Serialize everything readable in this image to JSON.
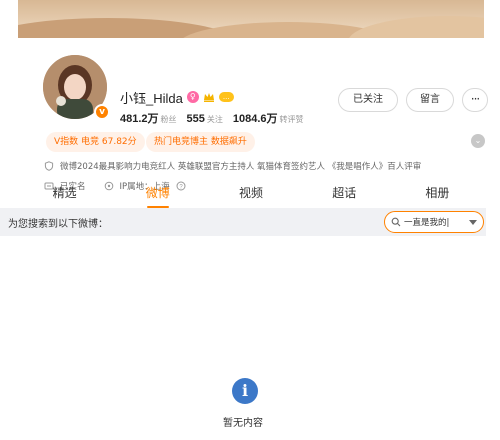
{
  "profile": {
    "name": "小钰_Hilda",
    "verified_badge": "v",
    "gender_icon": "female-icon",
    "vip_label": "...",
    "stats": [
      {
        "value": "481.2万",
        "label": "粉丝"
      },
      {
        "value": "555",
        "label": "关注"
      },
      {
        "value": "1084.6万",
        "label": "转评赞"
      }
    ],
    "actions": {
      "follow_label": "已关注",
      "message_label": "留言",
      "more_label": "···"
    },
    "tags": [
      "V指数 电竞 67.82分",
      "热门电竞博主 数据飙升"
    ],
    "bio": "微博2024最具影响力电竞红人 英雄联盟官方主持人 氧猫体育签约艺人 《我是唱作人》百人评审",
    "verification": "已实名",
    "ip_location": "IP属地：上海"
  },
  "tabs": [
    {
      "label": "精选",
      "active": false
    },
    {
      "label": "微博",
      "active": true
    },
    {
      "label": "视频",
      "active": false
    },
    {
      "label": "超话",
      "active": false
    },
    {
      "label": "相册",
      "active": false
    }
  ],
  "search": {
    "title": "为您搜索到以下微博：",
    "value": "一直是我的|"
  },
  "empty": {
    "text": "暂无内容"
  },
  "colors": {
    "accent": "#ff8200",
    "tag_bg": "#fff1e8",
    "info_blue": "#3c78c8"
  }
}
